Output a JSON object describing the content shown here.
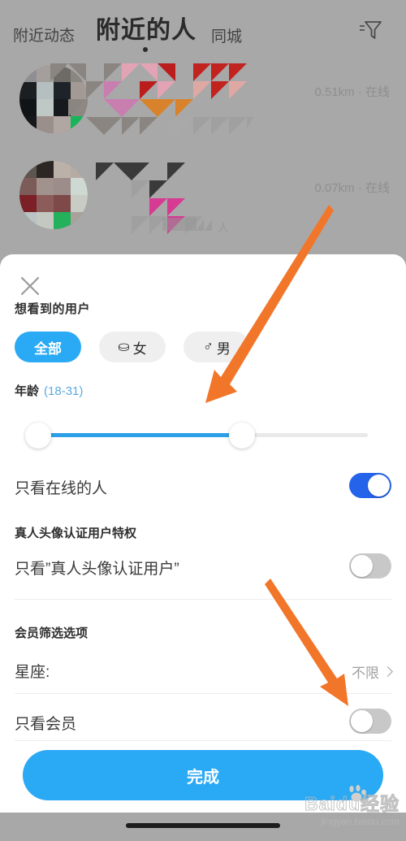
{
  "nav": {
    "tab_left": "附近动态",
    "tab_main": "附近的人",
    "tab_right": "同城",
    "filter_icon": "filter-funnel-icon"
  },
  "list": {
    "rows": [
      {
        "distance": "0.51km",
        "separator": "·",
        "status": "在线"
      },
      {
        "distance": "0.07km",
        "separator": "·",
        "status": "在线",
        "meta_suffix": "人"
      }
    ]
  },
  "sheet": {
    "close_icon": "close-x-icon",
    "title": "想看到的用户",
    "gender_chips": [
      {
        "label": "全部",
        "symbol": "",
        "selected": true
      },
      {
        "label": "女",
        "symbol": "⛀",
        "selected": false
      },
      {
        "label": "男",
        "symbol": "♂",
        "selected": false
      }
    ],
    "age": {
      "label": "年龄",
      "range": "(18-31)",
      "min": 18,
      "max": 31
    },
    "online_only": {
      "label": "只看在线的人",
      "enabled": true
    },
    "verified_section": {
      "heading": "真人头像认证用户特权",
      "row_label": "只看”真人头像认证用户”",
      "enabled": false
    },
    "member_section": {
      "heading": "会员筛选选项",
      "constellation": {
        "label": "星座:",
        "value": "不限",
        "chevron_icon": "chevron-right-icon"
      },
      "member_only": {
        "label": "只看会员",
        "enabled": false
      }
    },
    "done_label": "完成"
  },
  "watermark": {
    "brand": "Baidu经验",
    "url": "jingyan.baidu.com"
  },
  "colors": {
    "accent_blue": "#2aa9f4",
    "toggle_on_blue": "#2563eb",
    "slider_blue": "#2c9fe8",
    "arrow_orange": "#f2762a",
    "backdrop_gray": "#a8a8a8"
  }
}
